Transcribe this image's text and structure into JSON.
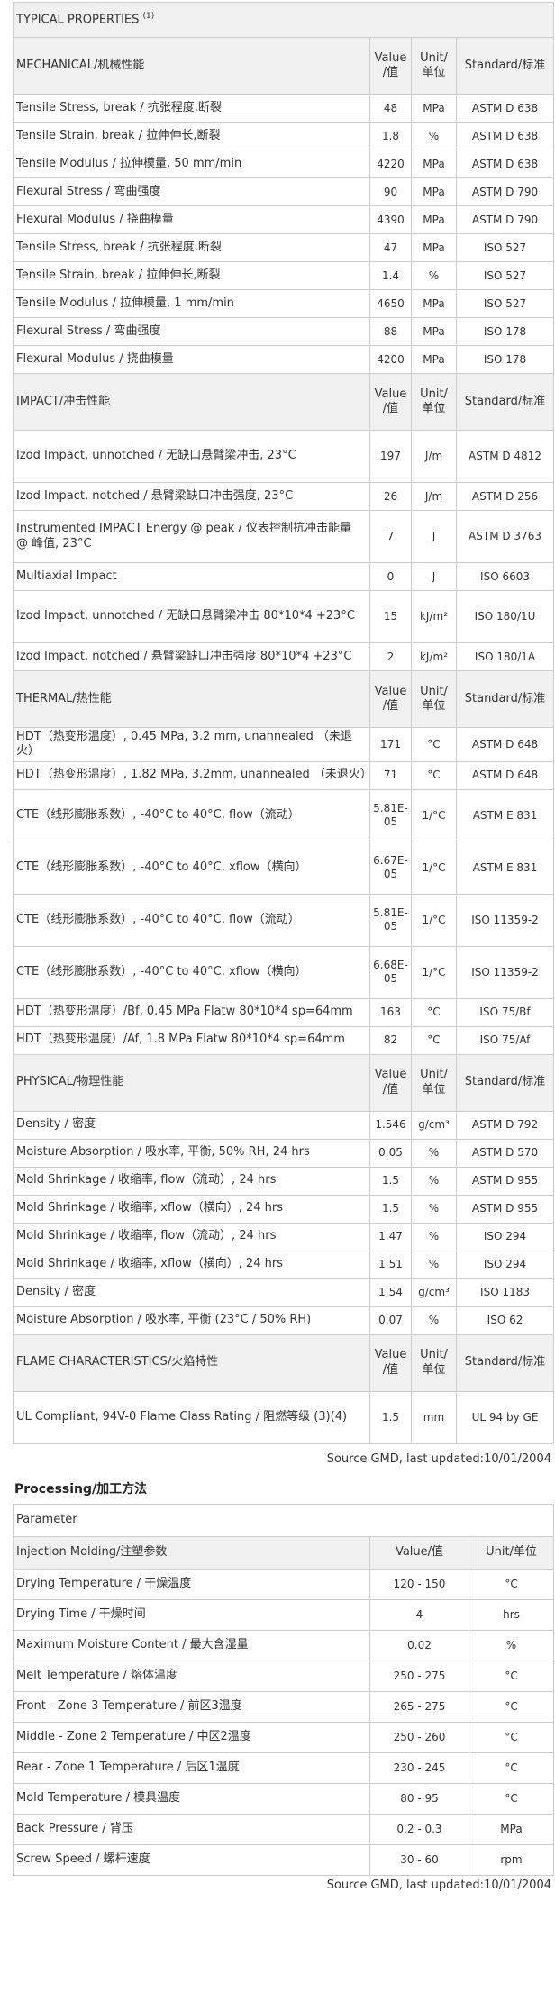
{
  "properties": {
    "title": "TYPICAL PROPERTIES",
    "title_sup": "(1)",
    "sections": [
      {
        "name": "MECHANICAL/机械性能",
        "col_value": "Value/值",
        "col_unit": "Unit/单位",
        "col_standard": "Standard/标准",
        "rows": [
          {
            "label": "Tensile Stress, break / 抗张程度,断裂",
            "value": "48",
            "unit": "MPa",
            "standard": "ASTM D 638"
          },
          {
            "label": "Tensile Strain, break / 拉伸伸长,断裂",
            "value": "1.8",
            "unit": "%",
            "standard": "ASTM D 638"
          },
          {
            "label": "Tensile Modulus / 拉伸模量, 50 mm/min",
            "value": "4220",
            "unit": "MPa",
            "standard": "ASTM D 638"
          },
          {
            "label": "Flexural Stress / 弯曲强度",
            "value": "90",
            "unit": "MPa",
            "standard": "ASTM D 790"
          },
          {
            "label": "Flexural Modulus / 挠曲模量",
            "value": "4390",
            "unit": "MPa",
            "standard": "ASTM D 790"
          },
          {
            "label": "Tensile Stress, break / 抗张程度,断裂",
            "value": "47",
            "unit": "MPa",
            "standard": "ISO 527"
          },
          {
            "label": "Tensile Strain, break / 拉伸伸长,断裂",
            "value": "1.4",
            "unit": "%",
            "standard": "ISO 527"
          },
          {
            "label": "Tensile Modulus / 拉伸模量, 1 mm/min",
            "value": "4650",
            "unit": "MPa",
            "standard": "ISO 527"
          },
          {
            "label": "Flexural Stress / 弯曲强度",
            "value": "88",
            "unit": "MPa",
            "standard": "ISO 178"
          },
          {
            "label": "Flexural Modulus / 挠曲模量",
            "value": "4200",
            "unit": "MPa",
            "standard": "ISO 178"
          }
        ]
      },
      {
        "name": "IMPACT/冲击性能",
        "col_value": "Value/值",
        "col_unit": "Unit/单位",
        "col_standard": "Standard/标准",
        "rows": [
          {
            "label": "Izod Impact, unnotched / 无缺口悬臂梁冲击, 23°C",
            "value": "197",
            "unit": "J/m",
            "standard": "ASTM D 4812"
          },
          {
            "label": "Izod Impact, notched / 悬臂梁缺口冲击强度, 23°C",
            "value": "26",
            "unit": "J/m",
            "standard": "ASTM D 256"
          },
          {
            "label": "Instrumented IMPACT Energy @ peak / 仪表控制抗冲击能量 @ 峰值, 23°C",
            "value": "7",
            "unit": "J",
            "standard": "ASTM D 3763"
          },
          {
            "label": "Multiaxial Impact",
            "value": "0",
            "unit": "J",
            "standard": "ISO 6603"
          },
          {
            "label": "Izod Impact, unnotched / 无缺口悬臂梁冲击 80*10*4 +23°C",
            "value": "15",
            "unit": "kJ/m²",
            "standard": "ISO 180/1U"
          },
          {
            "label": "Izod Impact, notched / 悬臂梁缺口冲击强度 80*10*4 +23°C",
            "value": "2",
            "unit": "kJ/m²",
            "standard": "ISO 180/1A"
          }
        ]
      },
      {
        "name": "THERMAL/热性能",
        "col_value": "Value/值",
        "col_unit": "Unit/单位",
        "col_standard": "Standard/标准",
        "rows": [
          {
            "label": "HDT（热变形温度）, 0.45 MPa, 3.2 mm, unannealed （未退火）",
            "value": "171",
            "unit": "°C",
            "standard": "ASTM D 648"
          },
          {
            "label": "HDT（热变形温度）, 1.82 MPa, 3.2mm, unannealed （未退火）",
            "value": "71",
            "unit": "°C",
            "standard": "ASTM D 648"
          },
          {
            "label": "CTE（线形膨胀系数）, -40°C to 40°C, flow（流动）",
            "value": "5.81E-05",
            "unit": "1/°C",
            "standard": "ASTM E 831"
          },
          {
            "label": "CTE（线形膨胀系数）, -40°C to 40°C, xflow（横向）",
            "value": "6.67E-05",
            "unit": "1/°C",
            "standard": "ASTM E 831"
          },
          {
            "label": "CTE（线形膨胀系数）, -40°C to 40°C, flow（流动）",
            "value": "5.81E-05",
            "unit": "1/°C",
            "standard": "ISO 11359-2"
          },
          {
            "label": "CTE（线形膨胀系数）, -40°C to 40°C, xflow（横向）",
            "value": "6.68E-05",
            "unit": "1/°C",
            "standard": "ISO 11359-2"
          },
          {
            "label": "HDT（热变形温度）/Bf, 0.45 MPa Flatw 80*10*4 sp=64mm",
            "value": "163",
            "unit": "°C",
            "standard": "ISO 75/Bf"
          },
          {
            "label": "HDT（热变形温度）/Af, 1.8 MPa Flatw 80*10*4 sp=64mm",
            "value": "82",
            "unit": "°C",
            "standard": "ISO 75/Af"
          }
        ]
      },
      {
        "name": "PHYSICAL/物理性能",
        "col_value": "Value/值",
        "col_unit": "Unit/单位",
        "col_standard": "Standard/标准",
        "rows": [
          {
            "label": "Density / 密度",
            "value": "1.546",
            "unit": "g/cm³",
            "standard": "ASTM D 792"
          },
          {
            "label": "Moisture Absorption / 吸水率, 平衡, 50% RH, 24 hrs",
            "value": "0.05",
            "unit": "%",
            "standard": "ASTM D 570"
          },
          {
            "label": "Mold Shrinkage / 收缩率, flow（流动）, 24 hrs",
            "value": "1.5",
            "unit": "%",
            "standard": "ASTM D 955"
          },
          {
            "label": "Mold Shrinkage / 收缩率, xflow（横向）, 24 hrs",
            "value": "1.5",
            "unit": "%",
            "standard": "ASTM D 955"
          },
          {
            "label": "Mold Shrinkage / 收缩率, flow（流动）, 24 hrs",
            "value": "1.47",
            "unit": "%",
            "standard": "ISO 294"
          },
          {
            "label": "Mold Shrinkage / 收缩率, xflow（横向）, 24 hrs",
            "value": "1.51",
            "unit": "%",
            "standard": "ISO 294"
          },
          {
            "label": "Density / 密度",
            "value": "1.54",
            "unit": "g/cm³",
            "standard": "ISO 1183"
          },
          {
            "label": "Moisture Absorption / 吸水率, 平衡 (23°C / 50% RH)",
            "value": "0.07",
            "unit": "%",
            "standard": "ISO 62"
          }
        ]
      },
      {
        "name": "FLAME CHARACTERISTICS/火焰特性",
        "col_value": "Value/值",
        "col_unit": "Unit/单位",
        "col_standard": "Standard/标准",
        "rows": [
          {
            "label": "UL Compliant, 94V-0 Flame Class Rating / 阻燃等级 (3)(4)",
            "value": "1.5",
            "unit": "mm",
            "standard": "UL 94 by GE"
          }
        ]
      }
    ],
    "source": "Source GMD, last updated:10/01/2004"
  },
  "processing": {
    "heading": "Processing/加工方法",
    "param_header": "Parameter",
    "section_name": "Injection Molding/注塑参数",
    "col_value": "Value/值",
    "col_unit": "Unit/单位",
    "rows": [
      {
        "label": "Drying Temperature / 干燥温度",
        "value": "120 - 150",
        "unit": "°C"
      },
      {
        "label": "Drying Time / 干燥时间",
        "value": "4",
        "unit": "hrs"
      },
      {
        "label": "Maximum Moisture Content / 最大含湿量",
        "value": "0.02",
        "unit": "%"
      },
      {
        "label": "Melt Temperature / 熔体温度",
        "value": "250 - 275",
        "unit": "°C"
      },
      {
        "label": "Front - Zone 3 Temperature / 前区3温度",
        "value": "265 - 275",
        "unit": "°C"
      },
      {
        "label": "Middle - Zone 2 Temperature / 中区2温度",
        "value": "250 - 260",
        "unit": "°C"
      },
      {
        "label": "Rear - Zone 1 Temperature / 后区1温度",
        "value": "230 - 245",
        "unit": "°C"
      },
      {
        "label": "Mold Temperature / 模具温度",
        "value": "80 - 95",
        "unit": "°C"
      },
      {
        "label": "Back Pressure / 背压",
        "value": "0.2 - 0.3",
        "unit": "MPa"
      },
      {
        "label": "Screw Speed / 螺杆速度",
        "value": "30 - 60",
        "unit": "rpm"
      }
    ],
    "source": "Source GMD, last updated:10/01/2004"
  }
}
